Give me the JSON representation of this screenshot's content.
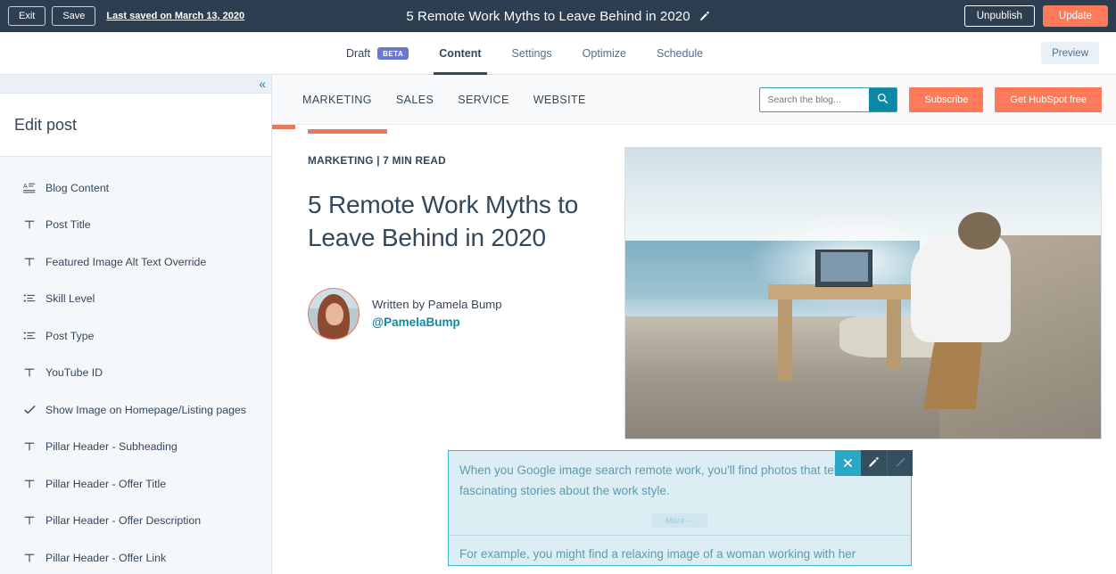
{
  "topbar": {
    "exit_label": "Exit",
    "save_label": "Save",
    "last_saved": "Last saved on March 13, 2020",
    "post_title": "5 Remote Work Myths to Leave Behind in 2020",
    "edit_title_icon": "pencil-icon",
    "unpublish_label": "Unpublish",
    "update_label": "Update",
    "update_color": "#ff7a59"
  },
  "tabbar": {
    "draft_label": "Draft",
    "beta_label": "BETA",
    "beta_color": "#6a78d1",
    "tabs": [
      {
        "label": "Content",
        "active": true
      },
      {
        "label": "Settings",
        "active": false
      },
      {
        "label": "Optimize",
        "active": false
      },
      {
        "label": "Schedule",
        "active": false
      }
    ],
    "preview_label": "Preview"
  },
  "sidebar": {
    "collapse_icon": "chevron-double-left-icon",
    "header": "Edit post",
    "items": [
      {
        "label": "Blog Content",
        "icon": "rich-text-icon"
      },
      {
        "label": "Post Title",
        "icon": "text-icon"
      },
      {
        "label": "Featured Image Alt Text Override",
        "icon": "text-icon"
      },
      {
        "label": "Skill Level",
        "icon": "list-icon"
      },
      {
        "label": "Post Type",
        "icon": "list-icon"
      },
      {
        "label": "YouTube ID",
        "icon": "text-icon"
      },
      {
        "label": "Show Image on Homepage/Listing pages",
        "icon": "checkmark-icon"
      },
      {
        "label": "Pillar Header - Subheading",
        "icon": "text-icon"
      },
      {
        "label": "Pillar Header - Offer Title",
        "icon": "text-icon"
      },
      {
        "label": "Pillar Header - Offer Description",
        "icon": "text-icon"
      },
      {
        "label": "Pillar Header - Offer Link",
        "icon": "text-icon"
      }
    ]
  },
  "preview": {
    "nav_links": [
      "MARKETING",
      "SALES",
      "SERVICE",
      "WEBSITE"
    ],
    "search": {
      "placeholder": "Search the blog...",
      "value": "",
      "icon": "search-icon"
    },
    "subscribe_label": "Subscribe",
    "cta_label": "Get HubSpot free",
    "accent_color": "#e8795a",
    "post": {
      "kicker": "MARKETING | 7 MIN READ",
      "title": "5 Remote Work Myths to Leave Behind in 2020",
      "author_written": "Written by Pamela Bump",
      "author_handle": "@PamelaBump",
      "featured_image_alt": "Woman working on a laptop at a wooden desk on a cliff overlooking the ocean"
    },
    "body": {
      "paragraph_1": "When you Google image search remote work, you'll find photos that tell fascinating stories about the work style.",
      "more_label": "More",
      "more_dots": "···",
      "paragraph_2": "For example, you might find a relaxing image of a woman working with her"
    },
    "selection_toolbar": {
      "close_icon": "close-icon",
      "edit_icon": "pencil-icon",
      "style_icon": "paintbrush-icon",
      "active_color": "#2aa7c4"
    }
  }
}
